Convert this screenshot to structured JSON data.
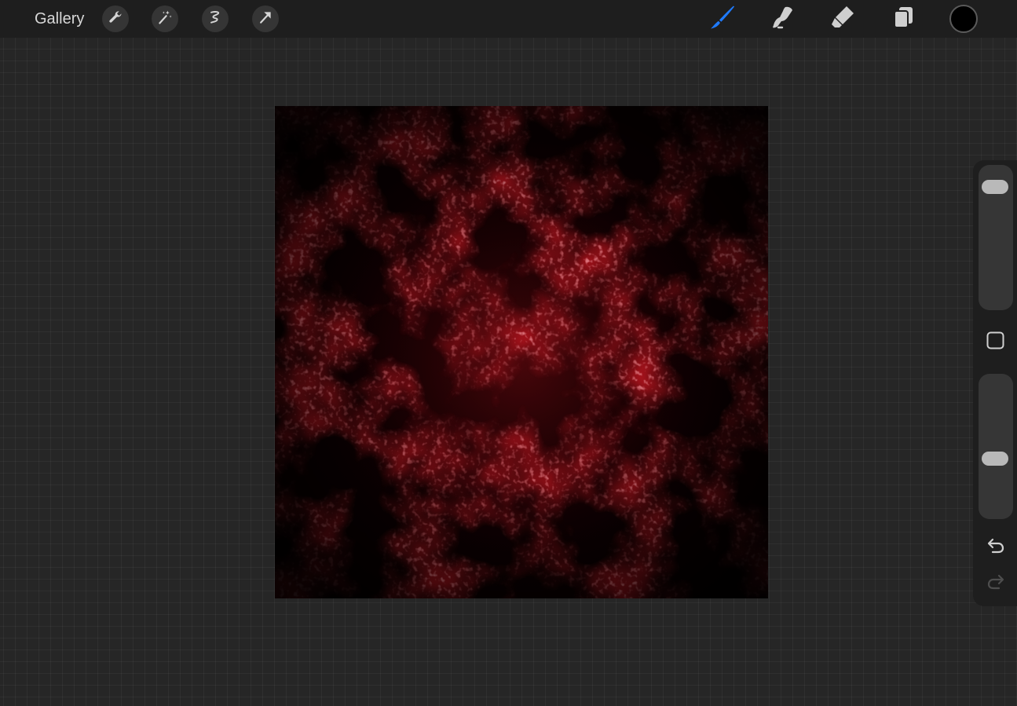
{
  "toolbar": {
    "gallery_label": "Gallery",
    "left_tools": [
      "wrench-icon",
      "magic-wand-icon",
      "selection-icon",
      "transform-arrow-icon"
    ],
    "right_tools": [
      "brush-icon",
      "smudge-icon",
      "eraser-icon",
      "layers-icon"
    ],
    "active_tool": "brush-icon",
    "active_color": "#000000",
    "accent_color": "#1f7bff"
  },
  "canvas": {
    "artwork": "red-black-texture",
    "colors": [
      "#000000",
      "#8a0b12",
      "#c4232b",
      "#e0707a"
    ]
  },
  "sidebar": {
    "size_slider": {
      "level": 0.0
    },
    "opacity_slider": {
      "level": 0.63
    },
    "modify_button": "square-icon",
    "undo": "undo-icon",
    "redo": "redo-icon"
  }
}
